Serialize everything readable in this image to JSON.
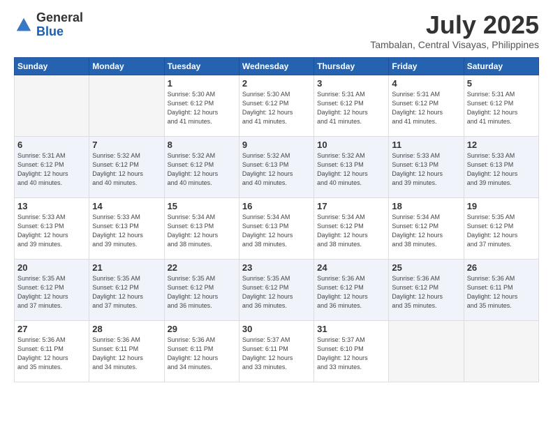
{
  "header": {
    "logo_general": "General",
    "logo_blue": "Blue",
    "title": "July 2025",
    "subtitle": "Tambalan, Central Visayas, Philippines"
  },
  "weekdays": [
    "Sunday",
    "Monday",
    "Tuesday",
    "Wednesday",
    "Thursday",
    "Friday",
    "Saturday"
  ],
  "weeks": [
    {
      "days": [
        {
          "num": "",
          "info": ""
        },
        {
          "num": "",
          "info": ""
        },
        {
          "num": "1",
          "info": "Sunrise: 5:30 AM\nSunset: 6:12 PM\nDaylight: 12 hours\nand 41 minutes."
        },
        {
          "num": "2",
          "info": "Sunrise: 5:30 AM\nSunset: 6:12 PM\nDaylight: 12 hours\nand 41 minutes."
        },
        {
          "num": "3",
          "info": "Sunrise: 5:31 AM\nSunset: 6:12 PM\nDaylight: 12 hours\nand 41 minutes."
        },
        {
          "num": "4",
          "info": "Sunrise: 5:31 AM\nSunset: 6:12 PM\nDaylight: 12 hours\nand 41 minutes."
        },
        {
          "num": "5",
          "info": "Sunrise: 5:31 AM\nSunset: 6:12 PM\nDaylight: 12 hours\nand 41 minutes."
        }
      ]
    },
    {
      "days": [
        {
          "num": "6",
          "info": "Sunrise: 5:31 AM\nSunset: 6:12 PM\nDaylight: 12 hours\nand 40 minutes."
        },
        {
          "num": "7",
          "info": "Sunrise: 5:32 AM\nSunset: 6:12 PM\nDaylight: 12 hours\nand 40 minutes."
        },
        {
          "num": "8",
          "info": "Sunrise: 5:32 AM\nSunset: 6:12 PM\nDaylight: 12 hours\nand 40 minutes."
        },
        {
          "num": "9",
          "info": "Sunrise: 5:32 AM\nSunset: 6:13 PM\nDaylight: 12 hours\nand 40 minutes."
        },
        {
          "num": "10",
          "info": "Sunrise: 5:32 AM\nSunset: 6:13 PM\nDaylight: 12 hours\nand 40 minutes."
        },
        {
          "num": "11",
          "info": "Sunrise: 5:33 AM\nSunset: 6:13 PM\nDaylight: 12 hours\nand 39 minutes."
        },
        {
          "num": "12",
          "info": "Sunrise: 5:33 AM\nSunset: 6:13 PM\nDaylight: 12 hours\nand 39 minutes."
        }
      ]
    },
    {
      "days": [
        {
          "num": "13",
          "info": "Sunrise: 5:33 AM\nSunset: 6:13 PM\nDaylight: 12 hours\nand 39 minutes."
        },
        {
          "num": "14",
          "info": "Sunrise: 5:33 AM\nSunset: 6:13 PM\nDaylight: 12 hours\nand 39 minutes."
        },
        {
          "num": "15",
          "info": "Sunrise: 5:34 AM\nSunset: 6:13 PM\nDaylight: 12 hours\nand 38 minutes."
        },
        {
          "num": "16",
          "info": "Sunrise: 5:34 AM\nSunset: 6:13 PM\nDaylight: 12 hours\nand 38 minutes."
        },
        {
          "num": "17",
          "info": "Sunrise: 5:34 AM\nSunset: 6:12 PM\nDaylight: 12 hours\nand 38 minutes."
        },
        {
          "num": "18",
          "info": "Sunrise: 5:34 AM\nSunset: 6:12 PM\nDaylight: 12 hours\nand 38 minutes."
        },
        {
          "num": "19",
          "info": "Sunrise: 5:35 AM\nSunset: 6:12 PM\nDaylight: 12 hours\nand 37 minutes."
        }
      ]
    },
    {
      "days": [
        {
          "num": "20",
          "info": "Sunrise: 5:35 AM\nSunset: 6:12 PM\nDaylight: 12 hours\nand 37 minutes."
        },
        {
          "num": "21",
          "info": "Sunrise: 5:35 AM\nSunset: 6:12 PM\nDaylight: 12 hours\nand 37 minutes."
        },
        {
          "num": "22",
          "info": "Sunrise: 5:35 AM\nSunset: 6:12 PM\nDaylight: 12 hours\nand 36 minutes."
        },
        {
          "num": "23",
          "info": "Sunrise: 5:35 AM\nSunset: 6:12 PM\nDaylight: 12 hours\nand 36 minutes."
        },
        {
          "num": "24",
          "info": "Sunrise: 5:36 AM\nSunset: 6:12 PM\nDaylight: 12 hours\nand 36 minutes."
        },
        {
          "num": "25",
          "info": "Sunrise: 5:36 AM\nSunset: 6:12 PM\nDaylight: 12 hours\nand 35 minutes."
        },
        {
          "num": "26",
          "info": "Sunrise: 5:36 AM\nSunset: 6:11 PM\nDaylight: 12 hours\nand 35 minutes."
        }
      ]
    },
    {
      "days": [
        {
          "num": "27",
          "info": "Sunrise: 5:36 AM\nSunset: 6:11 PM\nDaylight: 12 hours\nand 35 minutes."
        },
        {
          "num": "28",
          "info": "Sunrise: 5:36 AM\nSunset: 6:11 PM\nDaylight: 12 hours\nand 34 minutes."
        },
        {
          "num": "29",
          "info": "Sunrise: 5:36 AM\nSunset: 6:11 PM\nDaylight: 12 hours\nand 34 minutes."
        },
        {
          "num": "30",
          "info": "Sunrise: 5:37 AM\nSunset: 6:11 PM\nDaylight: 12 hours\nand 33 minutes."
        },
        {
          "num": "31",
          "info": "Sunrise: 5:37 AM\nSunset: 6:10 PM\nDaylight: 12 hours\nand 33 minutes."
        },
        {
          "num": "",
          "info": ""
        },
        {
          "num": "",
          "info": ""
        }
      ]
    }
  ]
}
